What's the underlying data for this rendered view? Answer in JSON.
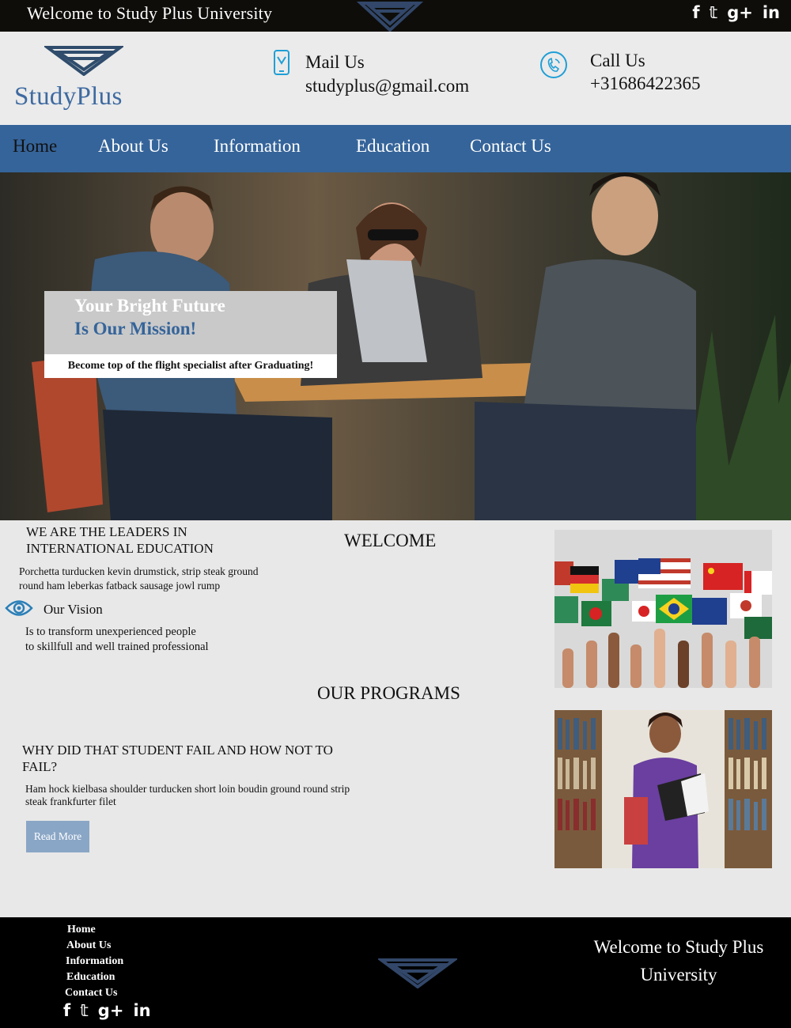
{
  "topbar": {
    "welcome_text": "Welcome to Study Plus  University",
    "social": [
      "f",
      "𝕥",
      "g+",
      "in"
    ]
  },
  "header": {
    "brand_name": "StudyPlus",
    "mail_label": "Mail Us",
    "mail_value": "studyplus@gmail.com",
    "call_label": "Call Us",
    "call_value": "+31686422365"
  },
  "nav": {
    "items": [
      "Home",
      "About Us",
      "Information",
      "Education",
      "Contact Us"
    ],
    "active": "Home"
  },
  "hero": {
    "title_line1": "Your Bright Future",
    "title_line2": "Is Our Mission!",
    "subtitle": "Become top of the flight specialist after Graduating!"
  },
  "content": {
    "leaders_line1": "WE ARE THE LEADERS IN",
    "leaders_line2": "INTERNATIONAL EDUCATION",
    "leaders_text_line1": "Porchetta turducken kevin drumstick, strip steak ground",
    "leaders_text_line2": "round ham leberkas fatback sausage jowl rump",
    "vision_title": "Our Vision",
    "vision_line1": "Is to transform unexperienced people",
    "vision_line2": "to skillfull and well trained professional",
    "welcome_heading": "WELCOME",
    "programs_heading": "OUR PROGRAMS",
    "why_heading": "WHY DID THAT STUDENT FAIL AND HOW  NOT TO FAIL?",
    "why_text": "Ham hock kielbasa shoulder turducken short loin boudin ground round strip steak frankfurter filet",
    "read_more": "Read More"
  },
  "footer": {
    "links": [
      "Home",
      "About Us",
      "Information",
      "Education",
      "Contact Us"
    ],
    "welcome_line1": "Welcome to Study Plus",
    "welcome_line2": "University",
    "social": [
      "f",
      "𝕥",
      "g+",
      "in"
    ]
  },
  "colors": {
    "brand_blue": "#35649a",
    "topbar_bg": "#0e0d0a",
    "footer_bg": "#000000",
    "read_more_bg": "#8aa6c6",
    "page_bg": "#e8e8e8"
  },
  "icons": {
    "logo": "diamond-logo-icon",
    "mail": "phone-mail-icon",
    "call": "phone-ring-icon",
    "vision": "eye-icon"
  }
}
